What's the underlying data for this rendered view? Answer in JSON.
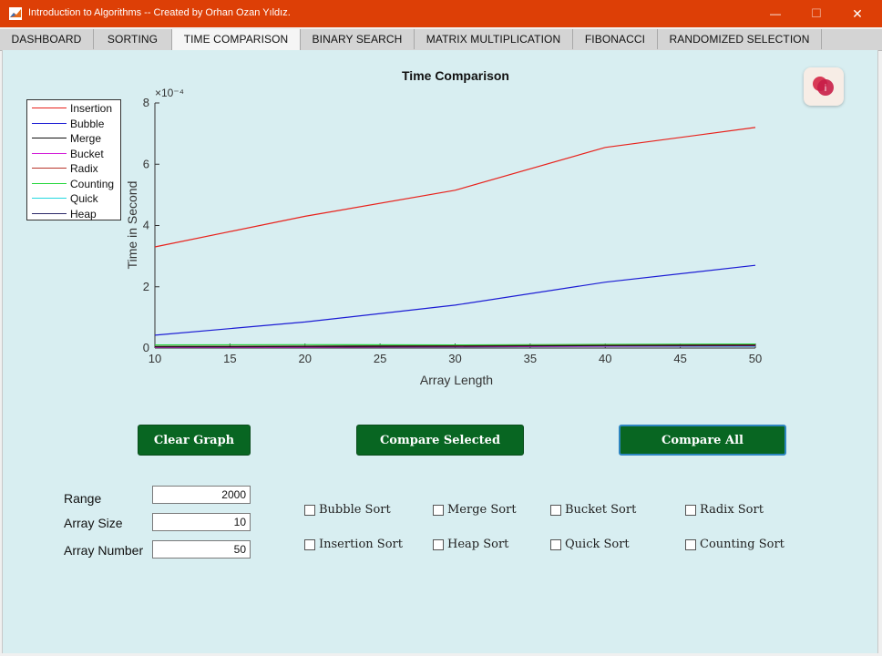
{
  "window": {
    "title": "Introduction to Algorithms -- Created by Orhan Ozan Yıldız.",
    "minimize_symbol": "—",
    "maximize_symbol": "☐",
    "close_symbol": "✕"
  },
  "tabs": [
    {
      "label": "DASHBOARD",
      "active": false
    },
    {
      "label": "SORTING",
      "active": false
    },
    {
      "label": "TIME COMPARISON",
      "active": true
    },
    {
      "label": "BINARY SEARCH",
      "active": false
    },
    {
      "label": "MATRIX MULTIPLICATION",
      "active": false
    },
    {
      "label": "FIBONACCI",
      "active": false
    },
    {
      "label": "RANDOMIZED SELECTION",
      "active": false
    }
  ],
  "chart_data": {
    "type": "line",
    "title": "Time Comparison",
    "xlabel": "Array Length",
    "ylabel": "Time in Second",
    "exponent_label": "×10⁻⁴",
    "xlim": [
      10,
      50
    ],
    "ylim": [
      0,
      8
    ],
    "x_ticks": [
      10,
      15,
      20,
      25,
      30,
      35,
      40,
      45,
      50
    ],
    "y_ticks": [
      0,
      2,
      4,
      6,
      8
    ],
    "legend_position": "outside-left",
    "x": [
      10,
      20,
      30,
      40,
      50
    ],
    "series": [
      {
        "name": "Insertion",
        "color": "#e8221c",
        "values": [
          3.3,
          4.3,
          5.15,
          6.55,
          7.2
        ]
      },
      {
        "name": "Bubble",
        "color": "#1c1cd4",
        "values": [
          0.42,
          0.85,
          1.4,
          2.15,
          2.7
        ]
      },
      {
        "name": "Merge",
        "color": "#111111",
        "values": [
          0.04,
          0.05,
          0.06,
          0.08,
          0.09
        ]
      },
      {
        "name": "Bucket",
        "color": "#d21ed8",
        "values": [
          0.02,
          0.03,
          0.04,
          0.06,
          0.07
        ]
      },
      {
        "name": "Radix",
        "color": "#b8342a",
        "values": [
          0.05,
          0.06,
          0.07,
          0.09,
          0.1
        ]
      },
      {
        "name": "Counting",
        "color": "#22d63a",
        "values": [
          0.1,
          0.11,
          0.1,
          0.12,
          0.13
        ]
      },
      {
        "name": "Quick",
        "color": "#22d8e0",
        "values": [
          0.03,
          0.04,
          0.04,
          0.05,
          0.05
        ]
      },
      {
        "name": "Heap",
        "color": "#2c2a6a",
        "values": [
          0.05,
          0.06,
          0.08,
          0.11,
          0.12
        ]
      }
    ]
  },
  "buttons": {
    "clear": "Clear Graph",
    "compare_selected": "Compare Selected",
    "compare_all": "Compare All"
  },
  "fields": {
    "range_label": "Range",
    "range_value": "2000",
    "size_label": "Array Size",
    "size_value": "10",
    "number_label": "Array Number",
    "number_value": "50"
  },
  "checkboxes": [
    {
      "label": "Bubble Sort",
      "checked": false
    },
    {
      "label": "Merge Sort",
      "checked": false
    },
    {
      "label": "Bucket Sort",
      "checked": false
    },
    {
      "label": "Radix Sort",
      "checked": false
    },
    {
      "label": "Insertion Sort",
      "checked": false
    },
    {
      "label": "Heap Sort",
      "checked": false
    },
    {
      "label": "Quick Sort",
      "checked": false
    },
    {
      "label": "Counting Sort",
      "checked": false
    }
  ],
  "icons": {
    "app": "matlab-icon",
    "info": "info-icon"
  },
  "colors": {
    "titlebar": "#dd3f06",
    "panel": "#d8eef1",
    "button": "#086622"
  }
}
